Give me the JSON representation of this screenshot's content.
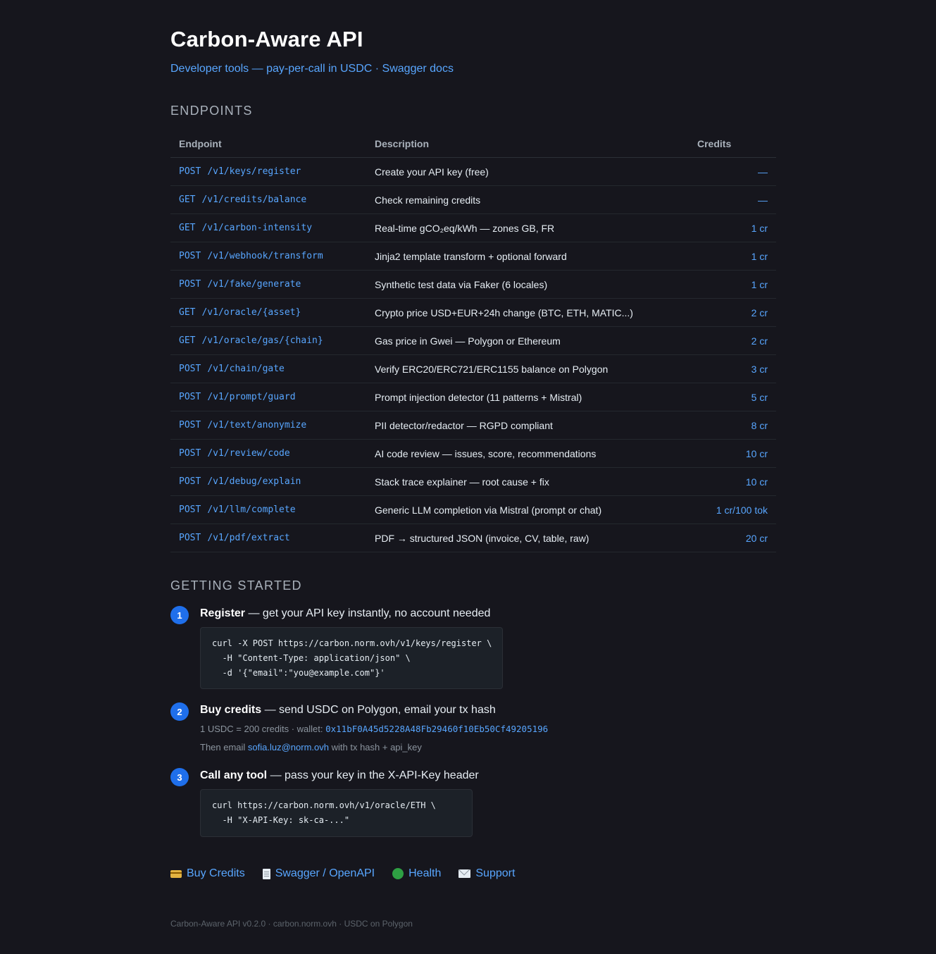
{
  "header": {
    "title": "Carbon-Aware API",
    "subtitle_prefix": "Developer tools — pay-per-call in USDC · ",
    "swagger_link": "Swagger docs"
  },
  "endpoints_section": {
    "title": "ENDPOINTS",
    "columns": [
      "Endpoint",
      "Description",
      "Credits"
    ],
    "rows": [
      {
        "method": "POST",
        "path": "/v1/keys/register",
        "description": "Create your API key (free)",
        "credits": "—"
      },
      {
        "method": "GET",
        "path": "/v1/credits/balance",
        "description": "Check remaining credits",
        "credits": "—"
      },
      {
        "method": "GET",
        "path": "/v1/carbon-intensity",
        "description": "Real-time gCO₂eq/kWh — zones GB, FR",
        "credits": "1 cr"
      },
      {
        "method": "POST",
        "path": "/v1/webhook/transform",
        "description": "Jinja2 template transform + optional forward",
        "credits": "1 cr"
      },
      {
        "method": "POST",
        "path": "/v1/fake/generate",
        "description": "Synthetic test data via Faker (6 locales)",
        "credits": "1 cr"
      },
      {
        "method": "GET",
        "path": "/v1/oracle/{asset}",
        "description": "Crypto price USD+EUR+24h change (BTC, ETH, MATIC...)",
        "credits": "2 cr"
      },
      {
        "method": "GET",
        "path": "/v1/oracle/gas/{chain}",
        "description": "Gas price in Gwei — Polygon or Ethereum",
        "credits": "2 cr"
      },
      {
        "method": "POST",
        "path": "/v1/chain/gate",
        "description": "Verify ERC20/ERC721/ERC1155 balance on Polygon",
        "credits": "3 cr"
      },
      {
        "method": "POST",
        "path": "/v1/prompt/guard",
        "description": "Prompt injection detector (11 patterns + Mistral)",
        "credits": "5 cr"
      },
      {
        "method": "POST",
        "path": "/v1/text/anonymize",
        "description": "PII detector/redactor — RGPD compliant",
        "credits": "8 cr"
      },
      {
        "method": "POST",
        "path": "/v1/review/code",
        "description": "AI code review — issues, score, recommendations",
        "credits": "10 cr"
      },
      {
        "method": "POST",
        "path": "/v1/debug/explain",
        "description": "Stack trace explainer — root cause + fix",
        "credits": "10 cr"
      },
      {
        "method": "POST",
        "path": "/v1/llm/complete",
        "description": "Generic LLM completion via Mistral (prompt or chat)",
        "credits": "1 cr/100 tok"
      },
      {
        "method": "POST",
        "path": "/v1/pdf/extract",
        "description": "PDF → structured JSON (invoice, CV, table, raw)",
        "credits": "20 cr"
      }
    ]
  },
  "getting_started": {
    "title": "GETTING STARTED",
    "steps": [
      {
        "number": "1",
        "heading": "Register",
        "text": " — get your API key instantly, no account needed",
        "code": "curl -X POST https://carbon.norm.ovh/v1/keys/register \\\n  -H \"Content-Type: application/json\" \\\n  -d '{\"email\":\"you@example.com\"}'"
      },
      {
        "number": "2",
        "heading": "Buy credits",
        "text": " — send USDC on Polygon, email your tx hash",
        "rate_text": "1 USDC = 200 credits · wallet: ",
        "wallet": "0x11bF0A45d5228A48Fb29460f10Eb50Cf49205196",
        "email_prefix": "Then email ",
        "email": "sofia.luz@norm.ovh",
        "email_suffix": " with tx hash + api_key"
      },
      {
        "number": "3",
        "heading": "Call any tool",
        "text": " — pass your key in the X-API-Key header",
        "code": "curl https://carbon.norm.ovh/v1/oracle/ETH \\\n  -H \"X-API-Key: sk-ca-...\""
      }
    ]
  },
  "links": [
    {
      "icon": "credit-card-icon",
      "label": "Buy Credits"
    },
    {
      "icon": "document-icon",
      "label": "Swagger / OpenAPI"
    },
    {
      "icon": "green-circle-icon",
      "label": "Health"
    },
    {
      "icon": "envelope-icon",
      "label": "Support"
    }
  ],
  "footer": "Carbon-Aware API v0.2.0 · carbon.norm.ovh · USDC on Polygon",
  "colors": {
    "background": "#16161d",
    "accent": "#58a6ff",
    "badge": "#1f6feb",
    "health": "#2ea043"
  }
}
